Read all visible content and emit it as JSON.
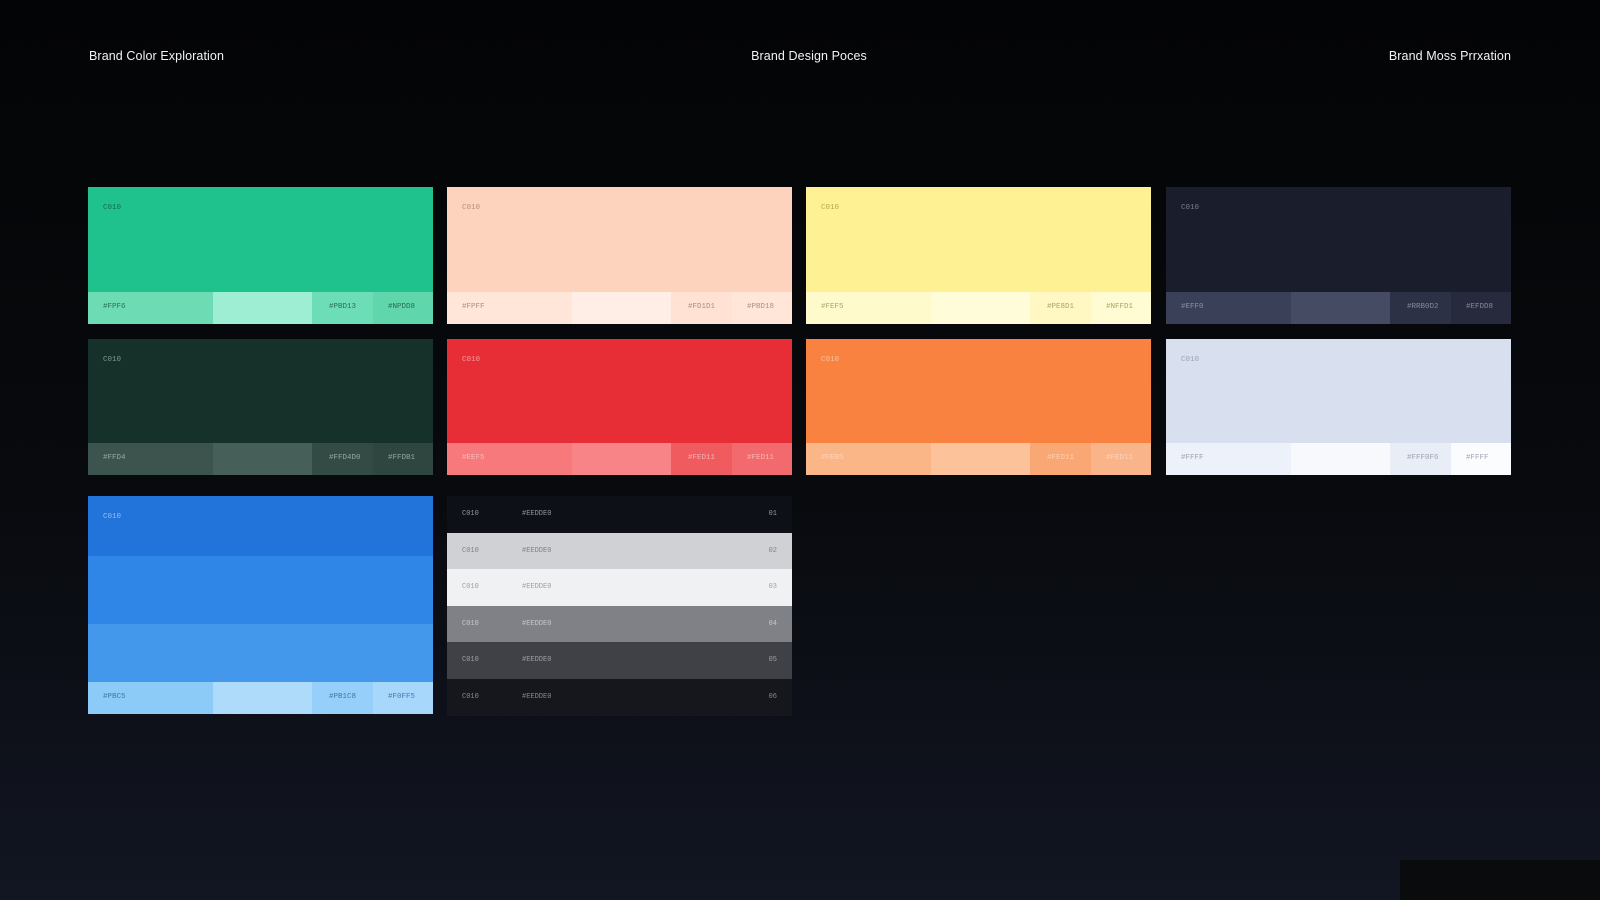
{
  "header": {
    "left": "Brand Color Exploration",
    "center": "Brand Design Poces",
    "right": "Brand Moss Prrxation"
  },
  "cards": [
    {
      "label": "C010",
      "main": "#1fc28c",
      "labelColor": "#0b3a2a",
      "strip": [
        {
          "text": "#FPF6",
          "color": "#6ddcb4"
        },
        {
          "text": "",
          "color": "#9eeed3"
        },
        {
          "text": "#PBD13",
          "color": "#6dddb7"
        },
        {
          "text": "#NPDD8",
          "color": "#5fd6ac"
        }
      ]
    },
    {
      "label": "C010",
      "main": "#fdd3bd",
      "labelColor": "#8a6a5a",
      "strip": [
        {
          "text": "#FPFF",
          "color": "#ffe6d8"
        },
        {
          "text": "",
          "color": "#ffeee5"
        },
        {
          "text": "#FD1D1",
          "color": "#ffe2d3"
        },
        {
          "text": "#PBD18",
          "color": "#ffe6d8"
        }
      ]
    },
    {
      "label": "C010",
      "main": "#fef193",
      "labelColor": "#8a7f3a",
      "strip": [
        {
          "text": "#FEF5",
          "color": "#fffacb"
        },
        {
          "text": "",
          "color": "#fffcd9"
        },
        {
          "text": "#PE8D1",
          "color": "#fff8c3"
        },
        {
          "text": "#NFFD1",
          "color": "#fffbd2"
        }
      ]
    },
    {
      "label": "C010",
      "main": "#1a1d2c",
      "labelColor": "#aab0c4",
      "strip": [
        {
          "text": "#EFF0",
          "color": "#3a4058"
        },
        {
          "text": "",
          "color": "#454b63"
        },
        {
          "text": "#RRB0D2",
          "color": "#2c3146"
        },
        {
          "text": "#EFDD8",
          "color": "#262a3c"
        }
      ]
    },
    {
      "label": "C010",
      "main": "#16302a",
      "labelColor": "#b8cdc5",
      "strip": [
        {
          "text": "#FFD4",
          "color": "#3c544d"
        },
        {
          "text": "",
          "color": "#465f58"
        },
        {
          "text": "#FFD4D0",
          "color": "#344b45"
        },
        {
          "text": "#FFDB1",
          "color": "#2f4540"
        }
      ]
    },
    {
      "label": "C010",
      "main": "#e72e36",
      "labelColor": "#f8d2d3",
      "strip": [
        {
          "text": "#EEF5",
          "color": "#f8797c"
        },
        {
          "text": "",
          "color": "#f98487"
        },
        {
          "text": "#FED11",
          "color": "#f05b60"
        },
        {
          "text": "#FED11",
          "color": "#f26a6d"
        }
      ]
    },
    {
      "label": "C010",
      "main": "#f98240",
      "labelColor": "#fde0cf",
      "strip": [
        {
          "text": "#FEB5",
          "color": "#fbb688"
        },
        {
          "text": "",
          "color": "#fcc299"
        },
        {
          "text": "#FED11",
          "color": "#f9a774"
        },
        {
          "text": "#FED11",
          "color": "#fab48a"
        }
      ]
    },
    {
      "label": "C010",
      "main": "#d8e0f0",
      "labelColor": "#7b8294",
      "strip": [
        {
          "text": "#FFFF",
          "color": "#edf1f9"
        },
        {
          "text": "",
          "color": "#f7f9fc"
        },
        {
          "text": "#FFF0F6",
          "color": "#e8edf6"
        },
        {
          "text": "#FFFF",
          "color": "#fbfcfe"
        }
      ]
    }
  ],
  "blue_card": {
    "label": "C010",
    "bands": [
      "#2273da",
      "#2f86e6",
      "#4498ec"
    ],
    "strip": [
      {
        "text": "#PBC5",
        "color": "#8ccaf8"
      },
      {
        "text": "",
        "color": "#aedbfa"
      },
      {
        "text": "#PB1C8",
        "color": "#95cffa"
      },
      {
        "text": "#F0FF5",
        "color": "#a7d7fb"
      }
    ]
  },
  "scale": [
    {
      "name": "C010",
      "hex": "#EEDDE0",
      "index": "01",
      "bg": "#0e1017",
      "fg": "#c9ccd4"
    },
    {
      "name": "C010",
      "hex": "#EEDDE0",
      "index": "02",
      "bg": "#cfd1d5",
      "fg": "#5b5f66"
    },
    {
      "name": "C010",
      "hex": "#EEDDE0",
      "index": "03",
      "bg": "#f0f1f3",
      "fg": "#7a7d83"
    },
    {
      "name": "C010",
      "hex": "#EEDDE0",
      "index": "04",
      "bg": "#7f8186",
      "fg": "#e2e3e6"
    },
    {
      "name": "C010",
      "hex": "#EEDDE0",
      "index": "05",
      "bg": "#3f4146",
      "fg": "#c2c4c8"
    },
    {
      "name": "C010",
      "hex": "#EEDDE0",
      "index": "06",
      "bg": "#15171c",
      "fg": "#b5b8bf"
    }
  ]
}
